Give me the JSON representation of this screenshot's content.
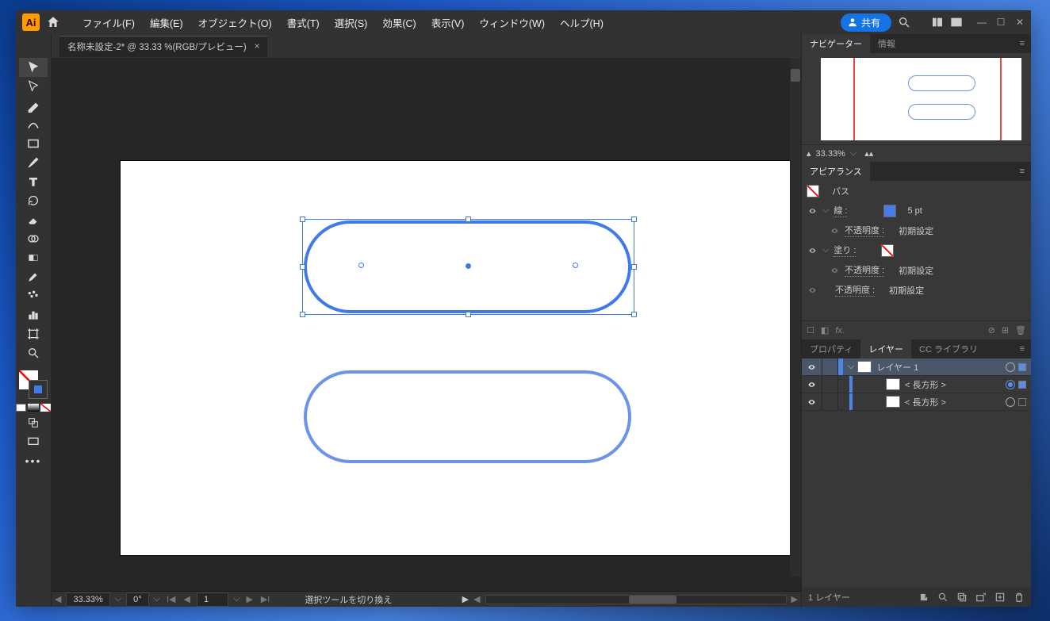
{
  "app": {
    "logo": "Ai"
  },
  "menu": {
    "file": "ファイル(F)",
    "edit": "編集(E)",
    "object": "オブジェクト(O)",
    "type": "書式(T)",
    "select": "選択(S)",
    "effect": "効果(C)",
    "view": "表示(V)",
    "window": "ウィンドウ(W)",
    "help": "ヘルプ(H)"
  },
  "titlebar": {
    "share": "共有"
  },
  "doc_tab": {
    "title": "名称未設定-2* @ 33.33 %(RGB/プレビュー)",
    "close": "×"
  },
  "status": {
    "zoom": "33.33%",
    "rotation": "0°",
    "page": "1",
    "hint": "選択ツールを切り換え"
  },
  "panels": {
    "navigator": {
      "tab": "ナビゲーター",
      "info": "情報",
      "zoom": "33.33%"
    },
    "appearance": {
      "tab": "アピアランス",
      "object": "パス",
      "stroke_label": "線 :",
      "stroke_value": "5 pt",
      "fill_label": "塗り :",
      "opacity_label": "不透明度 :",
      "opacity_value": "初期設定"
    },
    "props": {
      "properties": "プロパティ",
      "layers": "レイヤー",
      "cc": "CC ライブラリ"
    },
    "layers": {
      "layer1": "レイヤー 1",
      "rect": "< 長方形 >",
      "footer": "1 レイヤー"
    }
  }
}
